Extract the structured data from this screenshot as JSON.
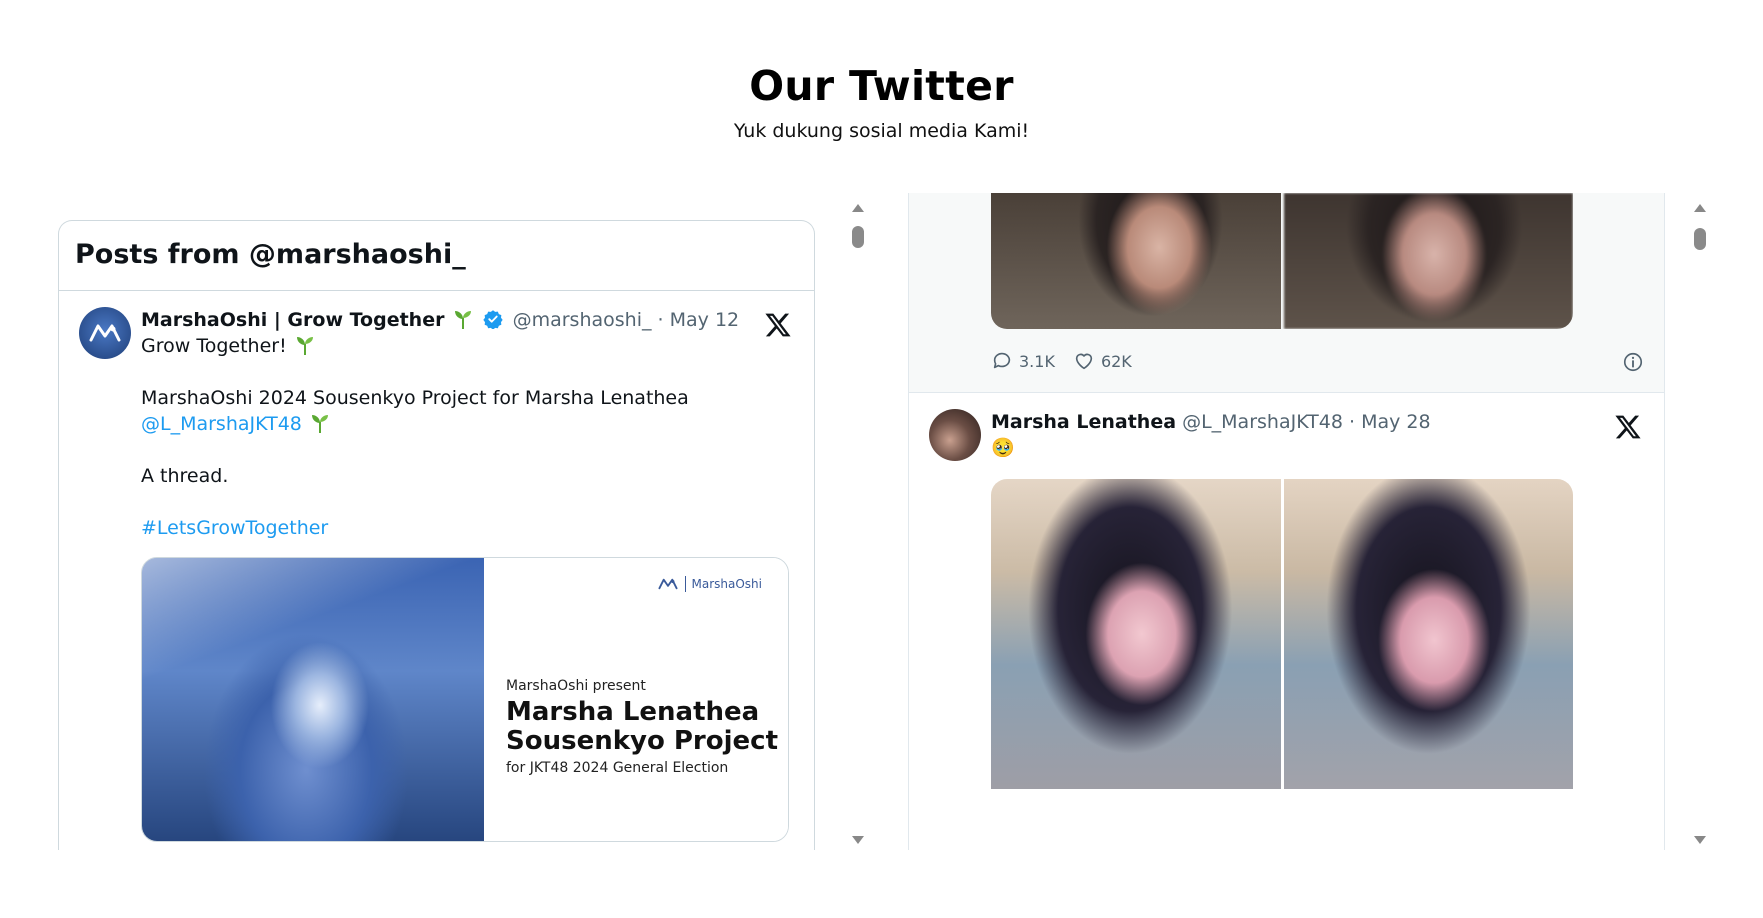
{
  "section": {
    "title": "Our Twitter",
    "subtitle": "Yuk dukung sosial media Kami!"
  },
  "left_embed": {
    "header_title": "Posts from @marshaoshi_",
    "tweet": {
      "author_name": "MarshaOshi | Grow Together",
      "handle": "@marshaoshi_",
      "date": "· May 12",
      "text_line1": "Grow Together!",
      "text_line2": "MarshaOshi 2024 Sousenkyo Project for Marsha Lenathea",
      "mention": "@L_MarshaJKT48",
      "text_line3": "A thread.",
      "hashtag": "#LetsGrowTogether",
      "card": {
        "brand": "MarshaOshi",
        "present": "MarshaOshi present",
        "title_line1": "Marsha Lenathea",
        "title_line2": "Sousenkyo Project",
        "for": "for JKT48 2024 General Election"
      }
    }
  },
  "right_embed": {
    "top_tweet": {
      "replies": "3.1K",
      "likes": "62K"
    },
    "tweet": {
      "author_name": "Marsha Lenathea",
      "handle": "@L_MarshaJKT48",
      "date": "· May 28",
      "emoji": "🥹"
    }
  },
  "icons": {
    "x_logo": "x-logo-icon",
    "verified": "verified-badge-icon",
    "sprout": "seedling-icon",
    "reply": "reply-icon",
    "like": "heart-icon",
    "info": "info-icon"
  },
  "colors": {
    "link": "#1d9bf0",
    "verified": "#1d9bf0",
    "sprout": "#5aa832",
    "text_secondary": "#536471"
  }
}
